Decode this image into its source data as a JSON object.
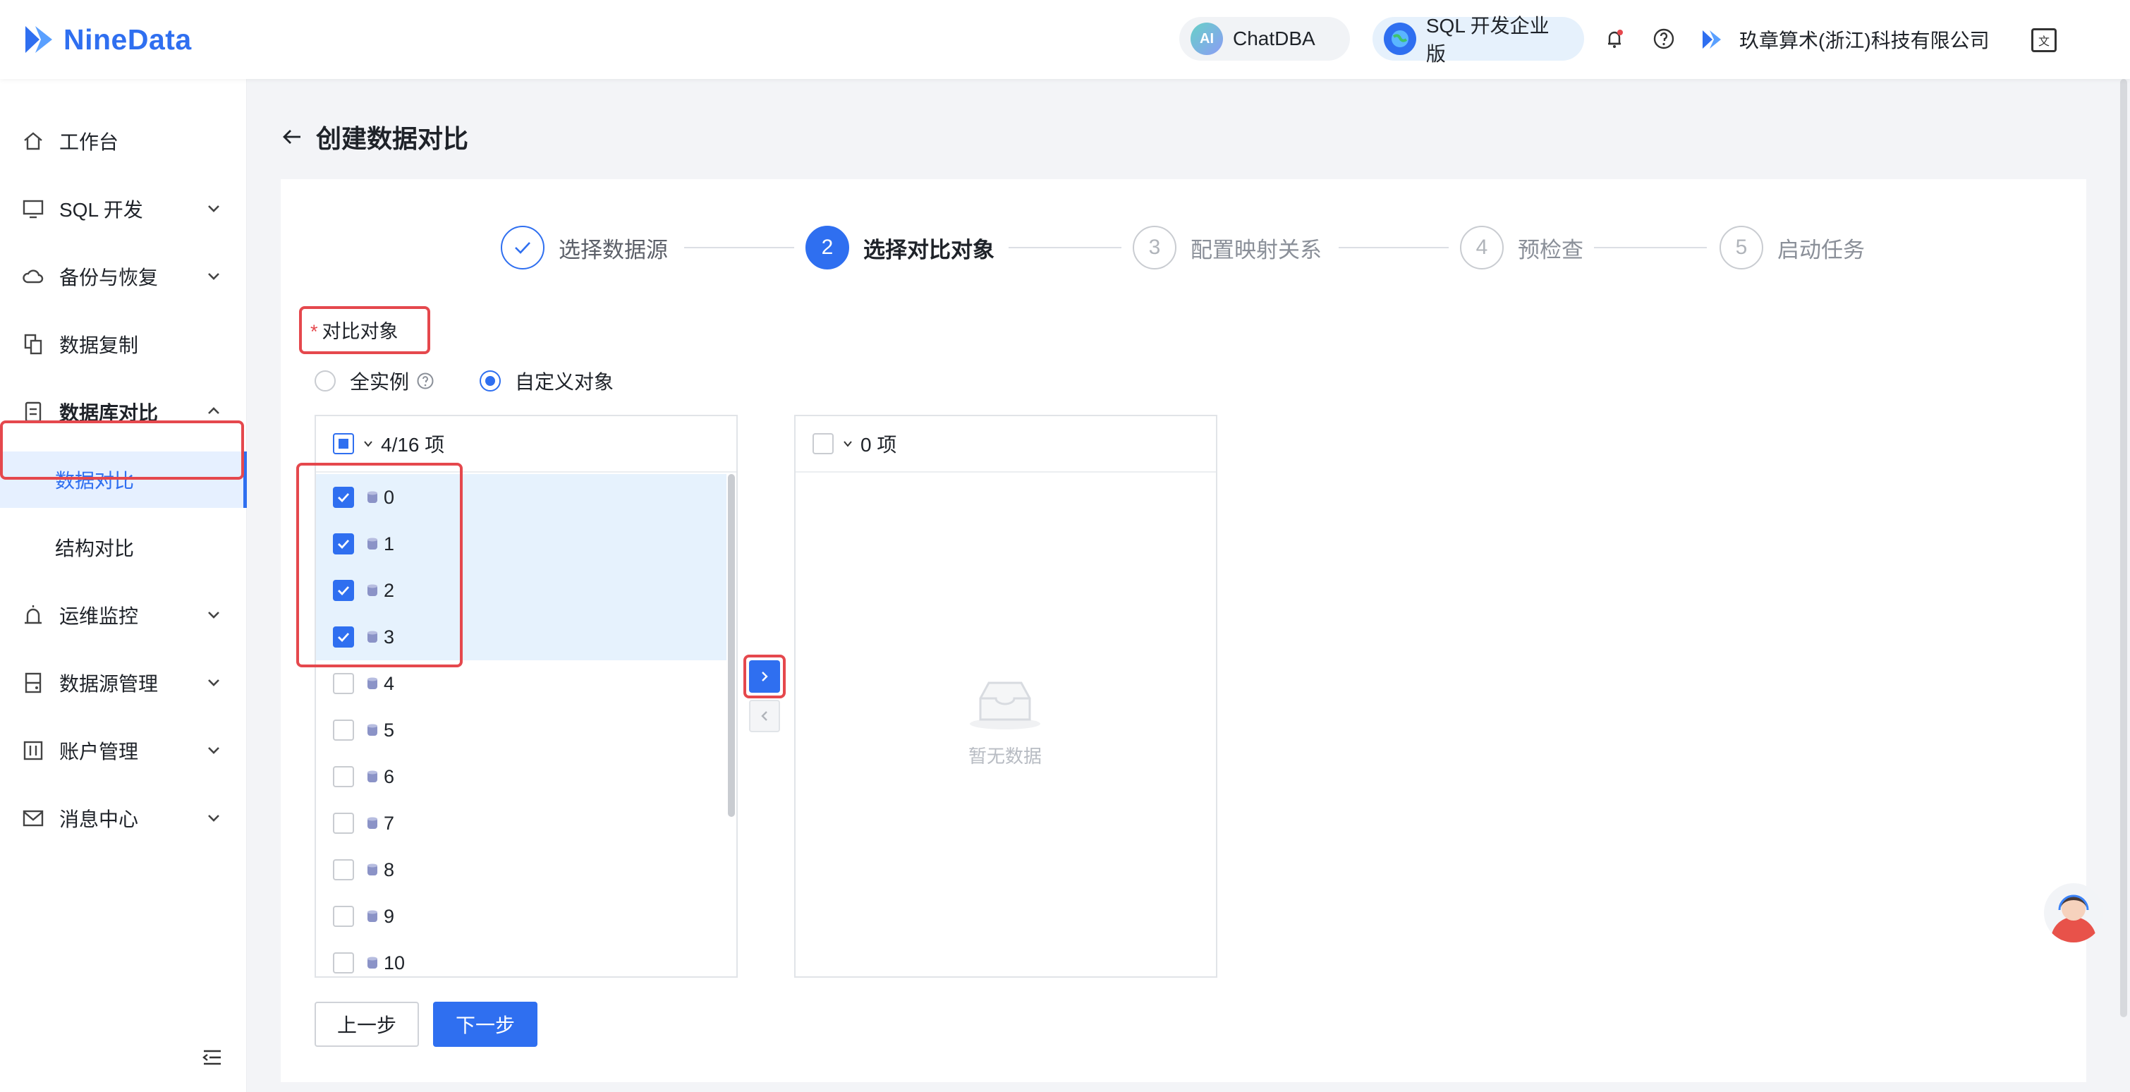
{
  "brand": {
    "name": "NineData"
  },
  "header": {
    "chatdba_label": "ChatDBA",
    "chatdba_icon_text": "AI",
    "edition_label": "SQL 开发企业版",
    "company": "玖章算术(浙江)科技有限公司"
  },
  "sidebar": {
    "items": [
      {
        "label": "工作台"
      },
      {
        "label": "SQL 开发"
      },
      {
        "label": "备份与恢复"
      },
      {
        "label": "数据复制"
      },
      {
        "label": "数据库对比"
      },
      {
        "label": "数据对比"
      },
      {
        "label": "结构对比"
      },
      {
        "label": "运维监控"
      },
      {
        "label": "数据源管理"
      },
      {
        "label": "账户管理"
      },
      {
        "label": "消息中心"
      }
    ]
  },
  "page": {
    "title": "创建数据对比"
  },
  "steps": [
    {
      "num": "",
      "label": "选择数据源",
      "state": "done"
    },
    {
      "num": "2",
      "label": "选择对比对象",
      "state": "current"
    },
    {
      "num": "3",
      "label": "配置映射关系",
      "state": "todo"
    },
    {
      "num": "4",
      "label": "预检查",
      "state": "todo"
    },
    {
      "num": "5",
      "label": "启动任务",
      "state": "todo"
    }
  ],
  "form": {
    "required_mark": "*",
    "label": "对比对象",
    "radio_all": "全实例",
    "radio_custom": "自定义对象"
  },
  "transfer": {
    "source_count": "4/16 项",
    "target_count": "0 项",
    "items": [
      "0",
      "1",
      "2",
      "3",
      "4",
      "5",
      "6",
      "7",
      "8",
      "9",
      "10"
    ],
    "checked": [
      true,
      true,
      true,
      true,
      false,
      false,
      false,
      false,
      false,
      false,
      false
    ],
    "empty_text": "暂无数据"
  },
  "buttons": {
    "prev": "上一步",
    "next": "下一步"
  },
  "colors": {
    "primary": "#2f6ff0",
    "highlight": "#e5484d",
    "selected_row": "#e6f2fd"
  }
}
